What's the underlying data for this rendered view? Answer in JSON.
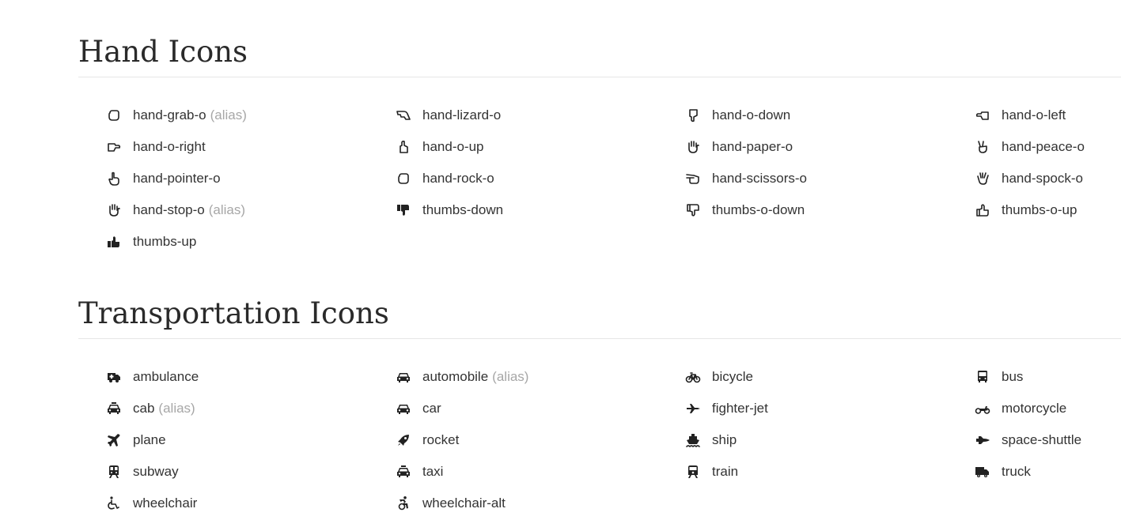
{
  "sections": [
    {
      "title": "Hand Icons",
      "items": [
        {
          "icon": "hand-grab-o-icon",
          "label": "hand-grab-o",
          "alias": "(alias)"
        },
        {
          "icon": "hand-lizard-o-icon",
          "label": "hand-lizard-o",
          "alias": ""
        },
        {
          "icon": "hand-o-down-icon",
          "label": "hand-o-down",
          "alias": ""
        },
        {
          "icon": "hand-o-left-icon",
          "label": "hand-o-left",
          "alias": ""
        },
        {
          "icon": "hand-o-right-icon",
          "label": "hand-o-right",
          "alias": ""
        },
        {
          "icon": "hand-o-up-icon",
          "label": "hand-o-up",
          "alias": ""
        },
        {
          "icon": "hand-paper-o-icon",
          "label": "hand-paper-o",
          "alias": ""
        },
        {
          "icon": "hand-peace-o-icon",
          "label": "hand-peace-o",
          "alias": ""
        },
        {
          "icon": "hand-pointer-o-icon",
          "label": "hand-pointer-o",
          "alias": ""
        },
        {
          "icon": "hand-rock-o-icon",
          "label": "hand-rock-o",
          "alias": ""
        },
        {
          "icon": "hand-scissors-o-icon",
          "label": "hand-scissors-o",
          "alias": ""
        },
        {
          "icon": "hand-spock-o-icon",
          "label": "hand-spock-o",
          "alias": ""
        },
        {
          "icon": "hand-stop-o-icon",
          "label": "hand-stop-o",
          "alias": "(alias)"
        },
        {
          "icon": "thumbs-down-icon",
          "label": "thumbs-down",
          "alias": ""
        },
        {
          "icon": "thumbs-o-down-icon",
          "label": "thumbs-o-down",
          "alias": ""
        },
        {
          "icon": "thumbs-o-up-icon",
          "label": "thumbs-o-up",
          "alias": ""
        },
        {
          "icon": "thumbs-up-icon",
          "label": "thumbs-up",
          "alias": ""
        }
      ]
    },
    {
      "title": "Transportation Icons",
      "items": [
        {
          "icon": "ambulance-icon",
          "label": "ambulance",
          "alias": ""
        },
        {
          "icon": "automobile-icon",
          "label": "automobile",
          "alias": "(alias)"
        },
        {
          "icon": "bicycle-icon",
          "label": "bicycle",
          "alias": ""
        },
        {
          "icon": "bus-icon",
          "label": "bus",
          "alias": ""
        },
        {
          "icon": "cab-icon",
          "label": "cab",
          "alias": "(alias)"
        },
        {
          "icon": "car-icon",
          "label": "car",
          "alias": ""
        },
        {
          "icon": "fighter-jet-icon",
          "label": "fighter-jet",
          "alias": ""
        },
        {
          "icon": "motorcycle-icon",
          "label": "motorcycle",
          "alias": ""
        },
        {
          "icon": "plane-icon",
          "label": "plane",
          "alias": ""
        },
        {
          "icon": "rocket-icon",
          "label": "rocket",
          "alias": ""
        },
        {
          "icon": "ship-icon",
          "label": "ship",
          "alias": ""
        },
        {
          "icon": "space-shuttle-icon",
          "label": "space-shuttle",
          "alias": ""
        },
        {
          "icon": "subway-icon",
          "label": "subway",
          "alias": ""
        },
        {
          "icon": "taxi-icon",
          "label": "taxi",
          "alias": ""
        },
        {
          "icon": "train-icon",
          "label": "train",
          "alias": ""
        },
        {
          "icon": "truck-icon",
          "label": "truck",
          "alias": ""
        },
        {
          "icon": "wheelchair-icon",
          "label": "wheelchair",
          "alias": ""
        },
        {
          "icon": "wheelchair-alt-icon",
          "label": "wheelchair-alt",
          "alias": ""
        }
      ]
    }
  ],
  "colors": {
    "text": "#333333",
    "alias": "#a7a7a7",
    "heading": "#2a2a2a",
    "divider": "#e6e6e6",
    "icon": "#222222"
  }
}
